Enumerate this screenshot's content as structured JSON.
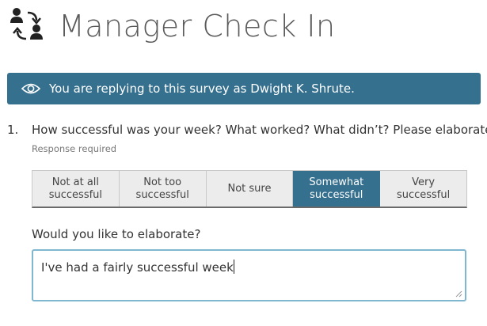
{
  "header": {
    "title": "Manager Check In",
    "icon": "people-exchange-icon"
  },
  "banner": {
    "icon": "eye-icon",
    "text": "You are replying to this survey as Dwight K. Shrute.",
    "color": "#35708f"
  },
  "question": {
    "number": "1.",
    "text": "How successful was your week? What worked? What didn’t? Please elaborate.",
    "required": "Response required",
    "options": [
      {
        "line1": "Not at all",
        "line2": "successful"
      },
      {
        "line1": "Not too",
        "line2": "successful"
      },
      {
        "line1": "Not sure",
        "line2": ""
      },
      {
        "line1": "Somewhat",
        "line2": "successful"
      },
      {
        "line1": "Very",
        "line2": "successful"
      }
    ],
    "selected_option": "Somewhat successful"
  },
  "elaborate": {
    "label": "Would you like to elaborate?",
    "value": "I've had a fairly successful week"
  }
}
